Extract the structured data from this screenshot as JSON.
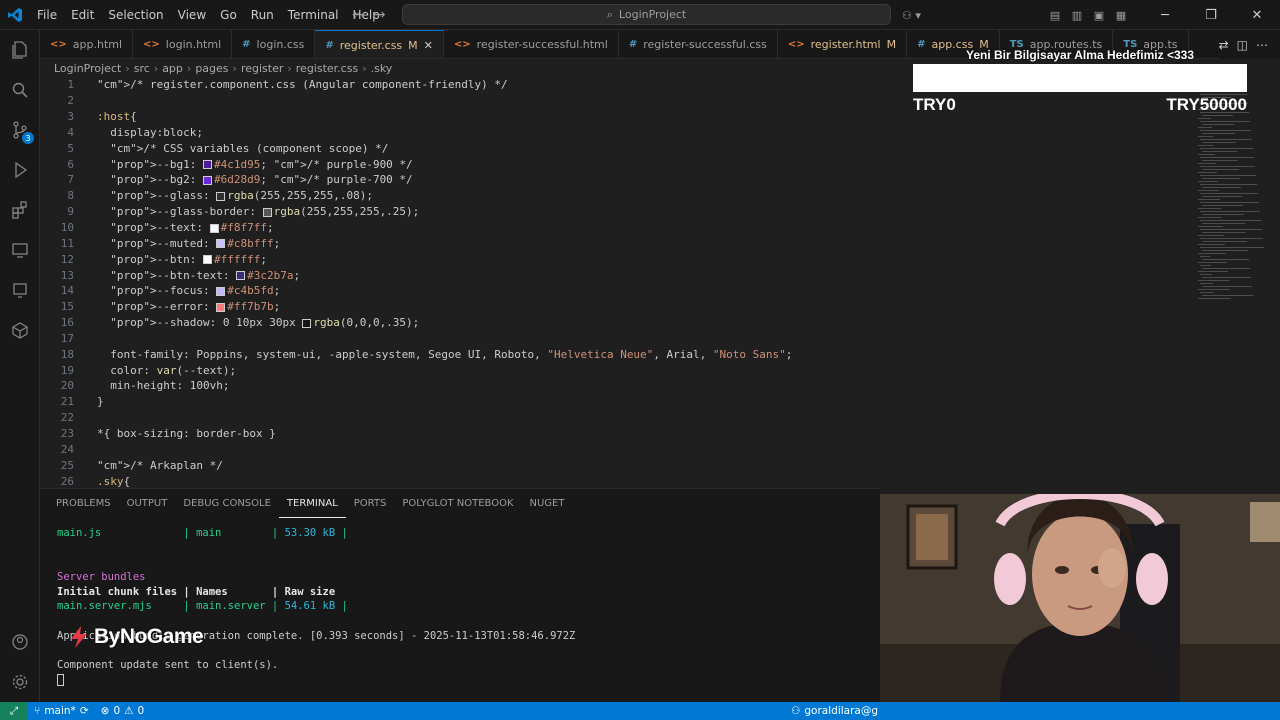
{
  "window": {
    "search_placeholder": "LoginProject"
  },
  "menu": [
    "File",
    "Edit",
    "Selection",
    "View",
    "Go",
    "Run",
    "Terminal",
    "Help"
  ],
  "tabs": [
    {
      "type": "html",
      "label": "app.html",
      "modified": false,
      "active": false
    },
    {
      "type": "html",
      "label": "login.html",
      "modified": false,
      "active": false
    },
    {
      "type": "css",
      "label": "login.css",
      "modified": false,
      "active": false
    },
    {
      "type": "css",
      "label": "register.css",
      "modified": true,
      "mod_mark": "M",
      "active": true
    },
    {
      "type": "html",
      "label": "register-successful.html",
      "modified": false,
      "active": false
    },
    {
      "type": "css",
      "label": "register-successful.css",
      "modified": false,
      "active": false
    },
    {
      "type": "html",
      "label": "register.html",
      "modified": true,
      "mod_mark": "M",
      "active": false
    },
    {
      "type": "css",
      "label": "app.css",
      "modified": true,
      "mod_mark": "M",
      "active": false
    },
    {
      "type": "ts",
      "label": "app.routes.ts",
      "modified": false,
      "active": false
    },
    {
      "type": "ts",
      "label": "app.ts",
      "modified": false,
      "active": false
    }
  ],
  "breadcrumb": [
    "LoginProject",
    "src",
    "app",
    "pages",
    "register",
    "register.css",
    ".sky"
  ],
  "code_lines": [
    {
      "n": "1",
      "text": "/* register.component.css (Angular component-friendly) */"
    },
    {
      "n": "2",
      "text": ""
    },
    {
      "n": "3",
      "text": ":host{"
    },
    {
      "n": "4",
      "text": "  display:block;"
    },
    {
      "n": "5",
      "text": "  /* CSS variables (component scope) */"
    },
    {
      "n": "6",
      "text": "  --bg1: #4c1d95; /* purple-900 */"
    },
    {
      "n": "7",
      "text": "  --bg2: #6d28d9; /* purple-700 */"
    },
    {
      "n": "8",
      "text": "  --glass: rgba(255,255,255,.08);"
    },
    {
      "n": "9",
      "text": "  --glass-border: rgba(255,255,255,.25);"
    },
    {
      "n": "10",
      "text": "  --text: #f8f7ff;"
    },
    {
      "n": "11",
      "text": "  --muted: #c8bfff;"
    },
    {
      "n": "12",
      "text": "  --btn: #ffffff;"
    },
    {
      "n": "13",
      "text": "  --btn-text: #3c2b7a;"
    },
    {
      "n": "14",
      "text": "  --focus: #c4b5fd;"
    },
    {
      "n": "15",
      "text": "  --error: #ff7b7b;"
    },
    {
      "n": "16",
      "text": "  --shadow: 0 10px 30px rgba(0,0,0,.35);"
    },
    {
      "n": "17",
      "text": ""
    },
    {
      "n": "18",
      "text": "  font-family: Poppins, system-ui, -apple-system, Segoe UI, Roboto, \"Helvetica Neue\", Arial, \"Noto Sans\";"
    },
    {
      "n": "19",
      "text": "  color: var(--text);"
    },
    {
      "n": "20",
      "text": "  min-height: 100vh;"
    },
    {
      "n": "21",
      "text": "}"
    },
    {
      "n": "22",
      "text": ""
    },
    {
      "n": "23",
      "text": "*{ box-sizing: border-box }"
    },
    {
      "n": "24",
      "text": ""
    },
    {
      "n": "25",
      "text": "/* Arkaplan */"
    },
    {
      "n": "26",
      "text": ".sky{"
    }
  ],
  "swatches": {
    "6": "#4c1d95",
    "7": "#6d28d9",
    "8": "rgba(255,255,255,.08)",
    "9": "rgba(255,255,255,.25)",
    "10": "#f8f7ff",
    "11": "#c8bfff",
    "12": "#ffffff",
    "13": "#3c2b7a",
    "14": "#c4b5fd",
    "15": "#ff7b7b",
    "16": "rgba(0,0,0,.35)"
  },
  "panel_tabs": [
    "PROBLEMS",
    "OUTPUT",
    "DEBUG CONSOLE",
    "TERMINAL",
    "PORTS",
    "POLYGLOT NOTEBOOK",
    "NUGET"
  ],
  "terminal_lines": [
    "main.js             | main        | 53.30 kB |",
    "",
    "",
    "Server bundles",
    "Initial chunk files | Names       | Raw size",
    "main.server.mjs     | main.server | 54.61 kB |",
    "",
    "Application bundle generation complete. [0.393 seconds] - 2025-11-13T01:58:46.972Z",
    "",
    "Component update sent to client(s)."
  ],
  "goal": {
    "title": "Yeni Bir Bilgisayar Alma Hedefimiz <333",
    "min_label": "TRY0",
    "max_label": "TRY50000",
    "progress": 0
  },
  "watermark": "ByNoGame",
  "status": {
    "branch": "main*",
    "errors": "0",
    "warnings": "0",
    "account": "goraldilara@g"
  }
}
